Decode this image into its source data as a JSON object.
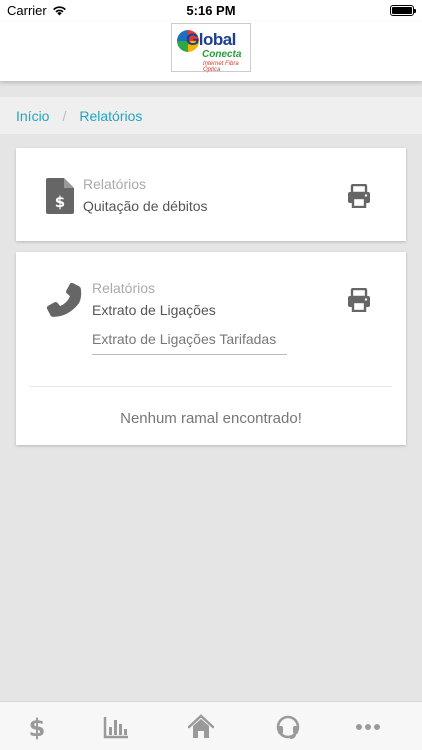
{
  "status": {
    "carrier": "Carrier",
    "time": "5:16 PM"
  },
  "header": {
    "logo_brand": "Global",
    "logo_sub": "Conecta",
    "logo_tagline": "Internet Fibra Óptica"
  },
  "breadcrumb": {
    "home": "Início",
    "separator": "/",
    "current": "Relatórios"
  },
  "cards": [
    {
      "category": "Relatórios",
      "title": "Quitação de débitos",
      "icon": "file-invoice-dollar-icon",
      "action_icon": "print-icon"
    },
    {
      "category": "Relatórios",
      "title": "Extrato de Ligações",
      "icon": "phone-icon",
      "action_icon": "print-icon",
      "select_value": "Extrato de Ligações Tarifadas",
      "empty_message": "Nenhum ramal encontrado!"
    }
  ],
  "tabbar": {
    "items": [
      "dollar-icon",
      "chart-bar-icon",
      "home-icon",
      "headset-icon",
      "more-icon"
    ],
    "icon_color": "#9a9a9a"
  },
  "colors": {
    "accent": "#1ea7c5",
    "icon": "#666666",
    "background": "#e5e5e5"
  }
}
